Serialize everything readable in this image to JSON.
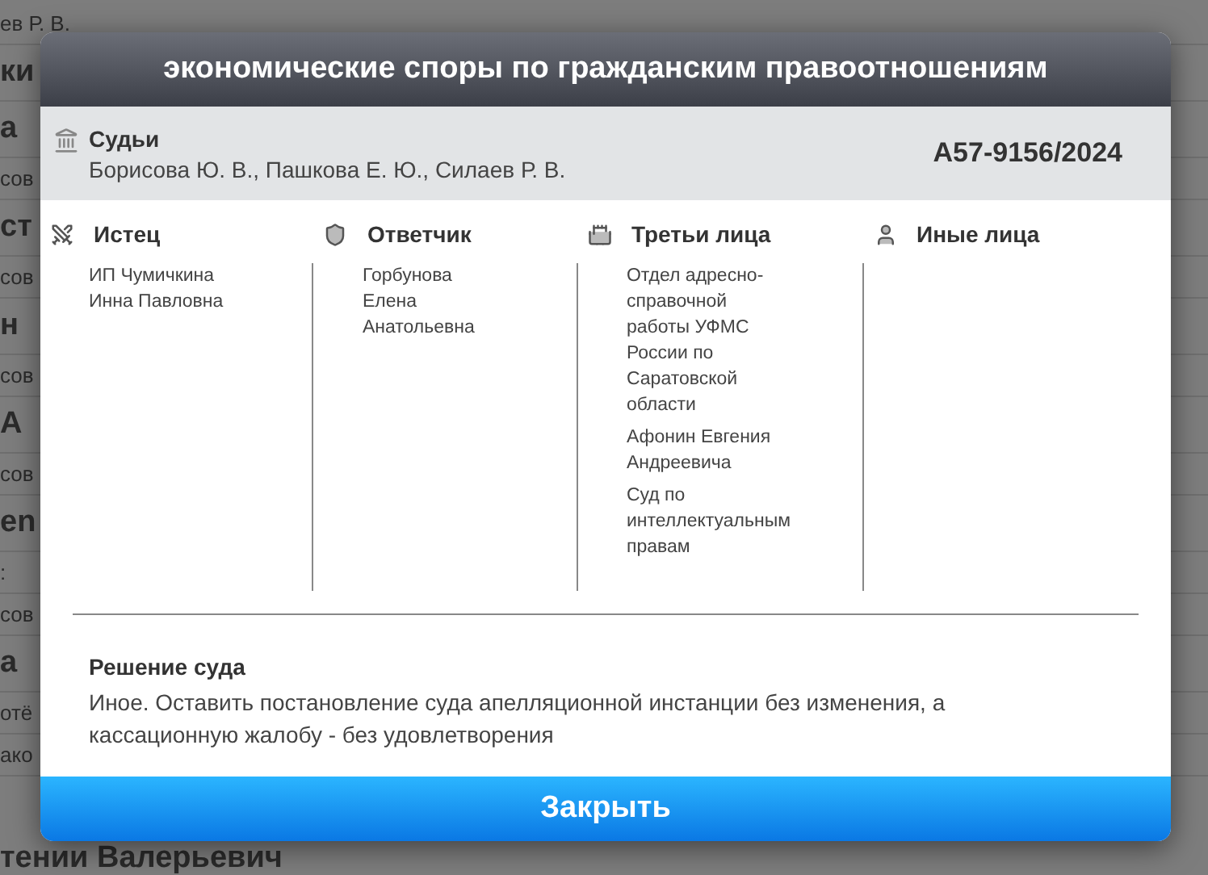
{
  "background_rows": [
    {
      "text": "ев Р. В.",
      "bold": false
    },
    {
      "text": "ки",
      "bold": true
    },
    {
      "text": "а",
      "bold": true
    },
    {
      "text": "сов",
      "bold": false
    },
    {
      "text": "ст",
      "bold": true
    },
    {
      "text": "сов",
      "bold": false
    },
    {
      "text": "н",
      "bold": true
    },
    {
      "text": "сов",
      "bold": false
    },
    {
      "text": "А",
      "bold": true
    },
    {
      "text": "сов",
      "bold": false
    },
    {
      "text": "en",
      "bold": true
    },
    {
      "text": ":",
      "bold": false
    },
    {
      "text": "сов",
      "bold": false
    },
    {
      "text": "а",
      "bold": true
    },
    {
      "text": "отё",
      "bold": false
    },
    {
      "text": "ако",
      "bold": false
    },
    {
      "text": "тении Валерьевич",
      "bold": true
    }
  ],
  "modal": {
    "title": "экономические споры по гражданским правоотношениям",
    "judges": {
      "label": "Судьи",
      "names": "Борисова Ю. В., Пашкова Е. Ю., Силаев Р. В."
    },
    "case_number": "А57-9156/2024",
    "parties": [
      {
        "kind": "plaintiff",
        "label": "Истец",
        "entries": [
          "ИП Чумичкина Инна Павловна"
        ]
      },
      {
        "kind": "defendant",
        "label": "Ответчик",
        "entries": [
          "Горбунова Елена Анатольевна"
        ]
      },
      {
        "kind": "third",
        "label": "Третьи лица",
        "entries": [
          "Отдел адресно-справочной работы УФМС России по Саратовской области",
          "Афонин Евгения Андреевича",
          "Суд по интеллектуальным правам"
        ]
      },
      {
        "kind": "other",
        "label": "Иные лица"
      }
    ],
    "decision": {
      "label": "Решение суда",
      "text": "Иное. Оставить постановление суда апелляционной инстанции без изменения, а кассационную жалобу - без удовлетворения"
    },
    "close_button": "Закрыть"
  }
}
